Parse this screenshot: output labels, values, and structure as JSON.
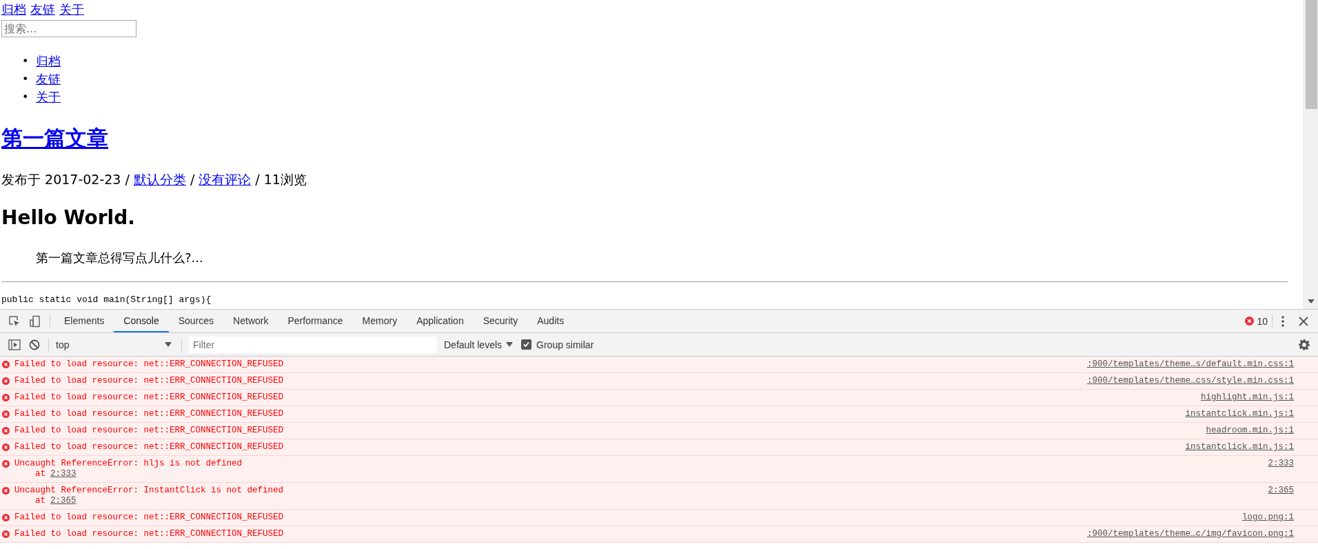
{
  "page": {
    "nav_links": [
      "归档",
      "友链",
      "关于"
    ],
    "search": {
      "placeholder": "搜索..."
    },
    "menu": [
      {
        "bullet": "•",
        "label": "归档"
      },
      {
        "bullet": "•",
        "label": "友链"
      },
      {
        "bullet": "•",
        "label": "关于"
      }
    ],
    "post": {
      "title": "第一篇文章",
      "meta": [
        {
          "kind": "text",
          "text": "发布于 2017-02-23 /"
        },
        {
          "kind": "link",
          "text": "默认分类"
        },
        {
          "kind": "text",
          "text": "/"
        },
        {
          "kind": "link",
          "text": "没有评论"
        },
        {
          "kind": "text",
          "text": "/ 11浏览"
        }
      ],
      "heading": "Hello World.",
      "quote": "第一篇文章总得写点儿什么?...",
      "code_line": "public static void main(String[] args){"
    }
  },
  "devtools": {
    "tabs": [
      {
        "label": "Elements",
        "selected": false
      },
      {
        "label": "Console",
        "selected": true
      },
      {
        "label": "Sources",
        "selected": false
      },
      {
        "label": "Network",
        "selected": false
      },
      {
        "label": "Performance",
        "selected": false
      },
      {
        "label": "Memory",
        "selected": false
      },
      {
        "label": "Application",
        "selected": false
      },
      {
        "label": "Security",
        "selected": false
      },
      {
        "label": "Audits",
        "selected": false
      }
    ],
    "error_count": "10",
    "context": "top",
    "filter": {
      "placeholder": "Filter"
    },
    "levels": "Default levels",
    "group_similar": {
      "label": "Group similar",
      "checked": true
    },
    "messages": [
      {
        "text": "Failed to load resource: net::ERR_CONNECTION_REFUSED",
        "source": ":900/templates/theme…s/default.min.css:1"
      },
      {
        "text": "Failed to load resource: net::ERR_CONNECTION_REFUSED",
        "source": ":900/templates/theme…css/style.min.css:1"
      },
      {
        "text": "Failed to load resource: net::ERR_CONNECTION_REFUSED",
        "source": "highlight.min.js:1"
      },
      {
        "text": "Failed to load resource: net::ERR_CONNECTION_REFUSED",
        "source": "instantclick.min.js:1"
      },
      {
        "text": "Failed to load resource: net::ERR_CONNECTION_REFUSED",
        "source": "headroom.min.js:1"
      },
      {
        "text": "Failed to load resource: net::ERR_CONNECTION_REFUSED",
        "source": "instantclick.min.js:1"
      },
      {
        "text": "Uncaught ReferenceError: hljs is not defined",
        "at_label": "at",
        "at_link": "2:333",
        "source": "2:333"
      },
      {
        "text": "Uncaught ReferenceError: InstantClick is not defined",
        "at_label": "at",
        "at_link": "2:365",
        "source": "2:365"
      },
      {
        "text": "Failed to load resource: net::ERR_CONNECTION_REFUSED",
        "source": "logo.png:1"
      },
      {
        "text": "Failed to load resource: net::ERR_CONNECTION_REFUSED",
        "source": ":900/templates/theme…c/img/favicon.png:1"
      }
    ]
  }
}
